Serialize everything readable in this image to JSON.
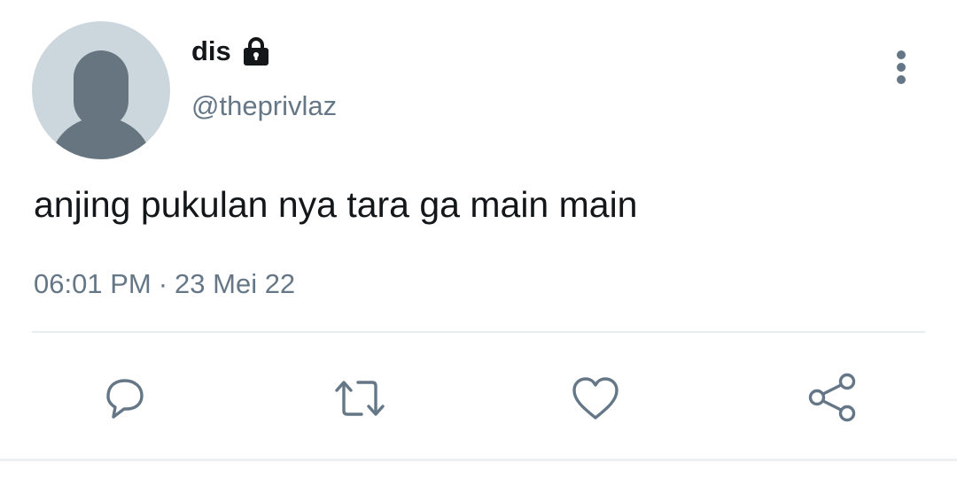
{
  "tweet": {
    "author": {
      "display_name": "dis",
      "handle": "@theprivlaz",
      "protected": true,
      "avatar": "default-avatar-placeholder"
    },
    "text": "anjing pukulan nya tara ga main main",
    "time": "06:01 PM",
    "separator": "·",
    "date": "23 Mei 22"
  },
  "actions": [
    {
      "name": "reply",
      "icon": "speech-bubble-icon"
    },
    {
      "name": "retweet",
      "icon": "retweet-icon"
    },
    {
      "name": "like",
      "icon": "heart-icon"
    },
    {
      "name": "share",
      "icon": "share-icon"
    }
  ],
  "menu": {
    "icon": "vertical-ellipsis-icon"
  },
  "colors": {
    "text_primary": "#14171a",
    "text_secondary": "#657786",
    "avatar_bg": "#ccd6dd",
    "avatar_figure": "#66757f",
    "divider": "#e6ecf0"
  }
}
